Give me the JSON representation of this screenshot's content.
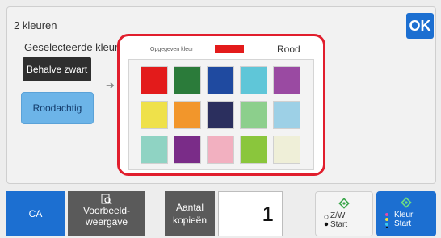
{
  "screen": {
    "title": "2 kleuren",
    "ok_label": "OK"
  },
  "left": {
    "selected_label": "Geselecteerde kleur",
    "btn_bw": "Behalve zwart",
    "btn_red": "Roodachtig"
  },
  "chooser": {
    "specified_label": "Opgegeven kleur",
    "specified_color": "#e31b1b",
    "color_name": "Rood",
    "colors": [
      [
        "#e31b1b",
        "#2b7b3a",
        "#1f4aa0",
        "#5fc6d8",
        "#9a4aa2"
      ],
      [
        "#efe14a",
        "#f2962b",
        "#2b2f5e",
        "#8ccf8c",
        "#9dd0e6"
      ],
      [
        "#8fd3c3",
        "#7a2c88",
        "#f2b0c0",
        "#8ac63c",
        "#efefd8"
      ]
    ]
  },
  "bottom": {
    "ca": "CA",
    "preview_line1": "Voorbeeld-",
    "preview_line2": "weergave",
    "copies_line1": "Aantal",
    "copies_line2": "kopieën",
    "copy_count": "1",
    "zw_line1": "Z/W",
    "zw_line2": "Start",
    "color_line1": "Kleur",
    "color_line2": "Start"
  }
}
